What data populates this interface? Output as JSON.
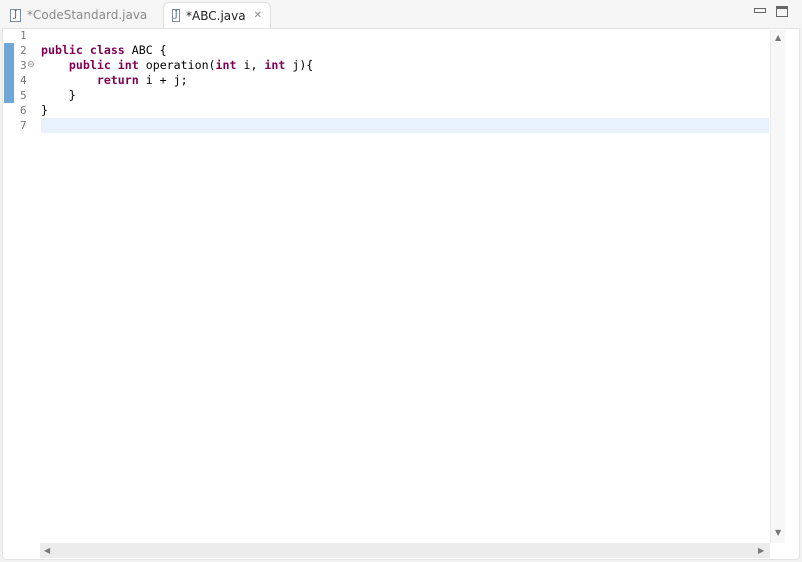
{
  "tabs": [
    {
      "label": "*CodeStandard.java",
      "icon": "java-file-icon",
      "active": false
    },
    {
      "label": "*ABC.java",
      "icon": "java-file-icon",
      "active": true,
      "close": "✕"
    }
  ],
  "window_controls": {
    "minimize": "minimize-icon",
    "maximize": "maximize-icon"
  },
  "editor": {
    "line_numbers": [
      "1",
      "2",
      "3",
      "4",
      "5",
      "6",
      "7"
    ],
    "fold_marker": "⊖",
    "current_line": 7,
    "lines": [
      [],
      [
        {
          "t": "public",
          "k": true
        },
        {
          "t": " "
        },
        {
          "t": "class",
          "k": true
        },
        {
          "t": " ABC {"
        }
      ],
      [
        {
          "t": "    "
        },
        {
          "t": "public",
          "k": true
        },
        {
          "t": " "
        },
        {
          "t": "int",
          "k": true
        },
        {
          "t": " operation("
        },
        {
          "t": "int",
          "k": true
        },
        {
          "t": " i, "
        },
        {
          "t": "int",
          "k": true
        },
        {
          "t": " j){"
        }
      ],
      [
        {
          "t": "        "
        },
        {
          "t": "return",
          "k": true
        },
        {
          "t": " i + j;"
        }
      ],
      [
        {
          "t": "    }"
        }
      ],
      [
        {
          "t": "}"
        }
      ],
      []
    ]
  },
  "colors": {
    "keyword": "#7f0055",
    "change_ruler": "#6fa8d6",
    "current_line": "#e8f2fe"
  }
}
